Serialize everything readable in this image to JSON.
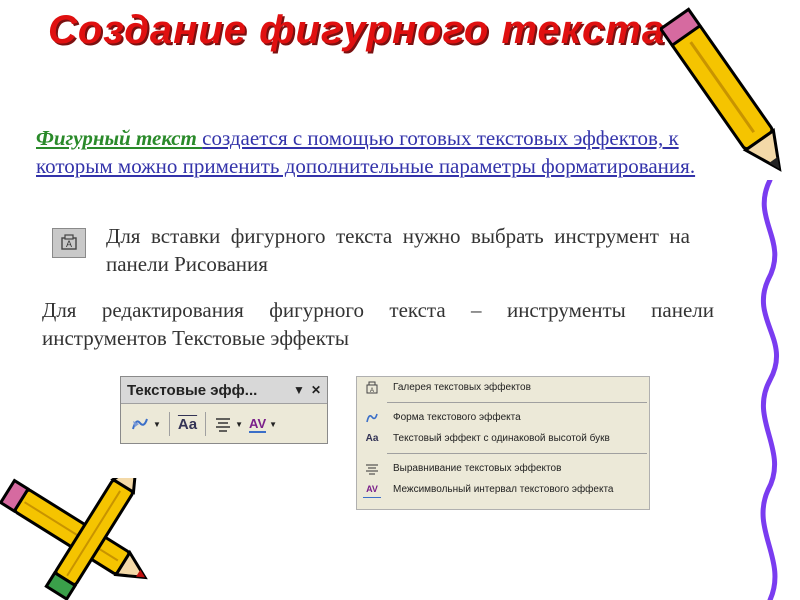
{
  "title": "Создание фигурного текста",
  "intro": {
    "lead": "Фигурный текст ",
    "text": "создается с помощью готовых текстовых эффектов, к которым можно применить дополнительные параметры форматирования."
  },
  "insert_text": "Для вставки фигурного текста нужно выбрать инструмент на панели Рисования",
  "edit_text": "Для редактирования фигурного текста – инструменты панели инструментов Текстовые эффекты",
  "toolbar": {
    "title": "Текстовые эфф...",
    "menu_btn": "▼",
    "close_btn": "✕",
    "aa_label": "Aa",
    "av_label": "AV"
  },
  "menu": {
    "items": [
      {
        "label": "Галерея текстовых эффектов",
        "icon": "fontwork-gallery-icon"
      },
      {
        "label": "Форма текстового эффекта",
        "icon": "fontwork-shape-icon"
      },
      {
        "label": "Текстовый эффект с одинаковой высотой букв",
        "icon": "same-letter-heights-icon"
      },
      {
        "label": "Выравнивание текстовых эффектов",
        "icon": "fontwork-alignment-icon"
      },
      {
        "label": "Межсимвольный интервал текстового эффекта",
        "icon": "character-spacing-icon"
      }
    ]
  },
  "colors": {
    "title": "#e01010",
    "lead": "#2a8a2a",
    "body": "#3333aa",
    "pencil": "#f5c400",
    "squiggle": "#7a3cf0"
  }
}
